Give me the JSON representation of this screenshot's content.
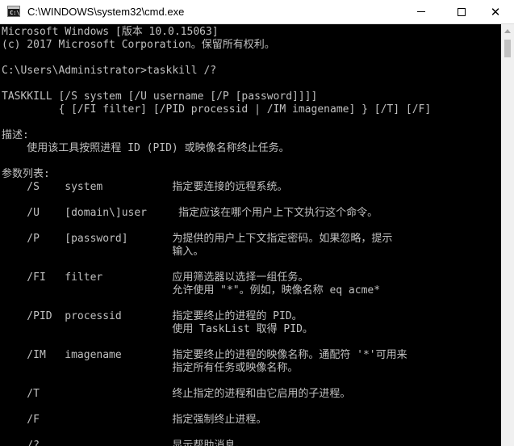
{
  "window": {
    "title": "C:\\WINDOWS\\system32\\cmd.exe",
    "icon": "console-icon",
    "icon_text": "C:\\"
  },
  "controls": {
    "minimize_icon": "minimize-icon",
    "maximize_icon": "maximize-icon",
    "close_glyph": "✕"
  },
  "console": {
    "lines": [
      "Microsoft Windows [版本 10.0.15063]",
      "(c) 2017 Microsoft Corporation。保留所有权利。",
      "",
      "C:\\Users\\Administrator>taskkill /?",
      "",
      "TASKKILL [/S system [/U username [/P [password]]]]",
      "         { [/FI filter] [/PID processid | /IM imagename] } [/T] [/F]",
      "",
      "描述:",
      "    使用该工具按照进程 ID (PID) 或映像名称终止任务。",
      "",
      "参数列表:",
      "    /S    system           指定要连接的远程系统。",
      "",
      "    /U    [domain\\]user     指定应该在哪个用户上下文执行这个命令。",
      "",
      "    /P    [password]       为提供的用户上下文指定密码。如果忽略，提示",
      "                           输入。",
      "",
      "    /FI   filter           应用筛选器以选择一组任务。",
      "                           允许使用 \"*\"。例如，映像名称 eq acme*",
      "",
      "    /PID  processid        指定要终止的进程的 PID。",
      "                           使用 TaskList 取得 PID。",
      "",
      "    /IM   imagename        指定要终止的进程的映像名称。通配符 '*'可用来",
      "                           指定所有任务或映像名称。",
      "",
      "    /T                     终止指定的进程和由它启用的子进程。",
      "",
      "    /F                     指定强制终止进程。",
      "",
      "    /?                     显示帮助消息。"
    ]
  },
  "colors": {
    "console_background": "#000000",
    "console_text": "#c0c0c0",
    "titlebar_background": "#ffffff"
  }
}
